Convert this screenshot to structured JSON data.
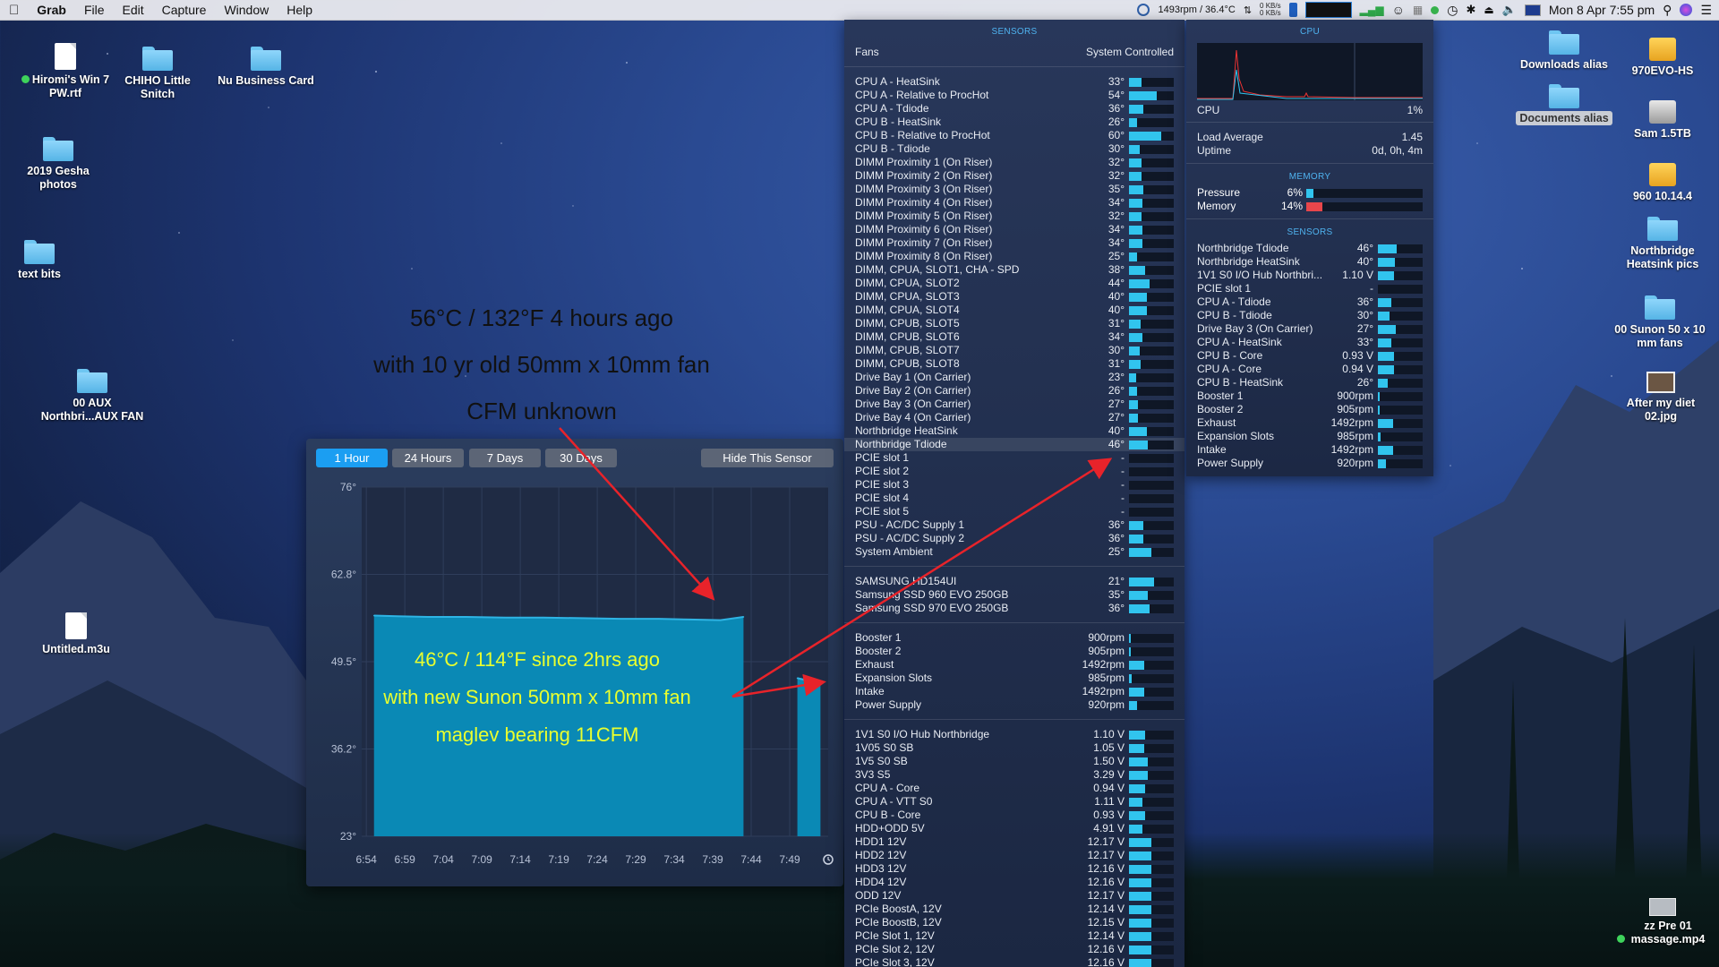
{
  "menubar": {
    "apple": "",
    "app": "Grab",
    "items": [
      "File",
      "Edit",
      "Capture",
      "Window",
      "Help"
    ],
    "status_fan": "1493rpm / 36.4°C",
    "net_up": "0 KB/s",
    "net_down": "0 KB/s",
    "clock": "Mon 8 Apr  7:55 pm"
  },
  "desktop": {
    "icons_left": [
      {
        "label": "Hiromi's Win 7 PW.rtf",
        "kind": "doc",
        "tag": "green"
      },
      {
        "label": "CHIHO Little Snitch",
        "kind": "folder"
      },
      {
        "label": "Nu Business Card",
        "kind": "folder"
      },
      {
        "label": "2019 Gesha photos",
        "kind": "folder"
      },
      {
        "label": "text bits",
        "kind": "folder"
      },
      {
        "label": "00 AUX Northbri...AUX FAN",
        "kind": "folder"
      },
      {
        "label": "Untitled.m3u",
        "kind": "doc"
      }
    ],
    "icons_right": [
      {
        "label": "Downloads alias",
        "kind": "folder"
      },
      {
        "label": "970EVO-HS",
        "kind": "drive"
      },
      {
        "label": "Documents alias",
        "kind": "folder"
      },
      {
        "label": "Sam 1.5TB",
        "kind": "drive-grey"
      },
      {
        "label": "960 10.14.4",
        "kind": "drive"
      },
      {
        "label": "Northbridge Heatsink pics",
        "kind": "folder"
      },
      {
        "label": "00 Sunon 50 x 10 mm fans",
        "kind": "folder"
      },
      {
        "label": "After my diet 02.jpg",
        "kind": "image"
      },
      {
        "label": "zz Pre 01 massage.mp4",
        "kind": "video",
        "tag": "green"
      }
    ]
  },
  "annotations": {
    "top": [
      "56°C / 132°F 4 hours ago",
      "with 10 yr old 50mm x 10mm fan",
      "CFM unknown"
    ],
    "bottom": [
      "46°C / 114°F since 2hrs ago",
      "with new Sunon 50mm x 10mm fan",
      "maglev bearing 11CFM"
    ]
  },
  "graph_window": {
    "tabs": [
      "1 Hour",
      "24 Hours",
      "7 Days",
      "30 Days"
    ],
    "active_tab": "1 Hour",
    "hide_button": "Hide This Sensor",
    "clock_icon": "clock-icon"
  },
  "chart_data": {
    "type": "area",
    "title": "",
    "xlabel": "",
    "ylabel": "",
    "y_ticks": [
      "76°",
      "62.8°",
      "49.5°",
      "36.2°",
      "23°"
    ],
    "ylim": [
      23,
      76
    ],
    "x_ticks": [
      "6:54",
      "6:59",
      "7:04",
      "7:09",
      "7:14",
      "7:19",
      "7:24",
      "7:29",
      "7:34",
      "7:39",
      "7:44",
      "7:49"
    ],
    "fill_color": "#0a89b5",
    "line_color": "#2fb4e4",
    "series": [
      {
        "values": [
          {
            "t": "6:55",
            "v": 56.5
          },
          {
            "t": "6:58",
            "v": 56.4
          },
          {
            "t": "7:02",
            "v": 56.3
          },
          {
            "t": "7:07",
            "v": 56.3
          },
          {
            "t": "7:12",
            "v": 56.2
          },
          {
            "t": "7:17",
            "v": 56.2
          },
          {
            "t": "7:22",
            "v": 56.1
          },
          {
            "t": "7:27",
            "v": 56.0
          },
          {
            "t": "7:32",
            "v": 56.0
          },
          {
            "t": "7:36",
            "v": 55.9
          },
          {
            "t": "7:40",
            "v": 55.8
          },
          {
            "t": "7:43",
            "v": 56.3
          }
        ]
      },
      {
        "values": [
          {
            "t": "7:50",
            "v": 47.0
          },
          {
            "t": "7:53",
            "v": 46.2
          }
        ]
      }
    ]
  },
  "sensors_panel": {
    "header": "SENSORS",
    "fans_label": "Fans",
    "fans_mode": "System Controlled",
    "temps": [
      {
        "name": "CPU A - HeatSink",
        "value": "33°",
        "level": 0.28
      },
      {
        "name": "CPU A - Relative to ProcHot",
        "value": "54°",
        "level": 0.62
      },
      {
        "name": "CPU A - Tdiode",
        "value": "36°",
        "level": 0.32
      },
      {
        "name": "CPU B - HeatSink",
        "value": "26°",
        "level": 0.18
      },
      {
        "name": "CPU B - Relative to ProcHot",
        "value": "60°",
        "level": 0.72
      },
      {
        "name": "CPU B - Tdiode",
        "value": "30°",
        "level": 0.24
      },
      {
        "name": "DIMM Proximity 1 (On Riser)",
        "value": "32°",
        "level": 0.27
      },
      {
        "name": "DIMM Proximity 2 (On Riser)",
        "value": "32°",
        "level": 0.27
      },
      {
        "name": "DIMM Proximity 3 (On Riser)",
        "value": "35°",
        "level": 0.31
      },
      {
        "name": "DIMM Proximity 4 (On Riser)",
        "value": "34°",
        "level": 0.3
      },
      {
        "name": "DIMM Proximity 5 (On Riser)",
        "value": "32°",
        "level": 0.27
      },
      {
        "name": "DIMM Proximity 6 (On Riser)",
        "value": "34°",
        "level": 0.3
      },
      {
        "name": "DIMM Proximity 7 (On Riser)",
        "value": "34°",
        "level": 0.3
      },
      {
        "name": "DIMM Proximity 8 (On Riser)",
        "value": "25°",
        "level": 0.17
      },
      {
        "name": "DIMM, CPUA, SLOT1, CHA - SPD",
        "value": "38°",
        "level": 0.36
      },
      {
        "name": "DIMM, CPUA, SLOT2",
        "value": "44°",
        "level": 0.46
      },
      {
        "name": "DIMM, CPUA, SLOT3",
        "value": "40°",
        "level": 0.4
      },
      {
        "name": "DIMM, CPUA, SLOT4",
        "value": "40°",
        "level": 0.4
      },
      {
        "name": "DIMM, CPUB, SLOT5",
        "value": "31°",
        "level": 0.26
      },
      {
        "name": "DIMM, CPUB, SLOT6",
        "value": "34°",
        "level": 0.3
      },
      {
        "name": "DIMM, CPUB, SLOT7",
        "value": "30°",
        "level": 0.24
      },
      {
        "name": "DIMM, CPUB, SLOT8",
        "value": "31°",
        "level": 0.26
      },
      {
        "name": "Drive Bay 1 (On Carrier)",
        "value": "23°",
        "level": 0.15
      },
      {
        "name": "Drive Bay 2 (On Carrier)",
        "value": "26°",
        "level": 0.18
      },
      {
        "name": "Drive Bay 3 (On Carrier)",
        "value": "27°",
        "level": 0.2
      },
      {
        "name": "Drive Bay 4 (On Carrier)",
        "value": "27°",
        "level": 0.2
      },
      {
        "name": "Northbridge HeatSink",
        "value": "40°",
        "level": 0.4
      },
      {
        "name": "Northbridge Tdiode",
        "value": "46°",
        "level": 0.42,
        "highlight": true
      },
      {
        "name": "PCIE slot 1",
        "value": "-",
        "level": 0
      },
      {
        "name": "PCIE slot 2",
        "value": "-",
        "level": 0
      },
      {
        "name": "PCIE slot 3",
        "value": "-",
        "level": 0
      },
      {
        "name": "PCIE slot 4",
        "value": "-",
        "level": 0
      },
      {
        "name": "PCIE slot 5",
        "value": "-",
        "level": 0
      },
      {
        "name": "PSU - AC/DC Supply 1",
        "value": "36°",
        "level": 0.32
      },
      {
        "name": "PSU - AC/DC Supply 2",
        "value": "36°",
        "level": 0.32
      },
      {
        "name": "System Ambient",
        "value": "25°",
        "level": 0.5
      }
    ],
    "drives": [
      {
        "name": "SAMSUNG HD154UI",
        "value": "21°",
        "level": 0.55
      },
      {
        "name": "Samsung SSD 960 EVO 250GB",
        "value": "35°",
        "level": 0.42
      },
      {
        "name": "Samsung SSD 970 EVO 250GB",
        "value": "36°",
        "level": 0.45
      }
    ],
    "fans": [
      {
        "name": "Booster 1",
        "value": "900rpm",
        "level": 0.04
      },
      {
        "name": "Booster 2",
        "value": "905rpm",
        "level": 0.04
      },
      {
        "name": "Exhaust",
        "value": "1492rpm",
        "level": 0.34
      },
      {
        "name": "Expansion Slots",
        "value": "985rpm",
        "level": 0.06
      },
      {
        "name": "Intake",
        "value": "1492rpm",
        "level": 0.34
      },
      {
        "name": "Power Supply",
        "value": "920rpm",
        "level": 0.18
      }
    ],
    "voltages": [
      {
        "name": "1V1 S0 I/O Hub Northbridge",
        "value": "1.10 V",
        "level": 0.36
      },
      {
        "name": "1V05 S0 SB",
        "value": "1.05 V",
        "level": 0.34
      },
      {
        "name": "1V5 S0 SB",
        "value": "1.50 V",
        "level": 0.42
      },
      {
        "name": "3V3 S5",
        "value": "3.29 V",
        "level": 0.42
      },
      {
        "name": "CPU A - Core",
        "value": "0.94 V",
        "level": 0.36
      },
      {
        "name": "CPU A - VTT S0",
        "value": "1.11 V",
        "level": 0.3
      },
      {
        "name": "CPU B - Core",
        "value": "0.93 V",
        "level": 0.36
      },
      {
        "name": "HDD+ODD 5V",
        "value": "4.91 V",
        "level": 0.3
      },
      {
        "name": "HDD1 12V",
        "value": "12.17 V",
        "level": 0.5
      },
      {
        "name": "HDD2 12V",
        "value": "12.17 V",
        "level": 0.5
      },
      {
        "name": "HDD3 12V",
        "value": "12.16 V",
        "level": 0.5
      },
      {
        "name": "HDD4 12V",
        "value": "12.16 V",
        "level": 0.5
      },
      {
        "name": "ODD 12V",
        "value": "12.17 V",
        "level": 0.5
      },
      {
        "name": "PCIe BoostA, 12V",
        "value": "12.14 V",
        "level": 0.5
      },
      {
        "name": "PCIe BoostB, 12V",
        "value": "12.15 V",
        "level": 0.5
      },
      {
        "name": "PCIe Slot 1, 12V",
        "value": "12.14 V",
        "level": 0.5
      },
      {
        "name": "PCIe Slot 2, 12V",
        "value": "12.16 V",
        "level": 0.5
      },
      {
        "name": "PCIe Slot 3, 12V",
        "value": "12.16 V",
        "level": 0.5
      }
    ]
  },
  "cpu_panel": {
    "header": "CPU",
    "cpu_label": "CPU",
    "cpu_value": "1%",
    "load_label": "Load Average",
    "load_value": "1.45",
    "uptime_label": "Uptime",
    "uptime_value": "0d, 0h, 4m",
    "memory_header": "MEMORY",
    "pressure_label": "Pressure",
    "pressure_value": "6%",
    "pressure_level": 0.06,
    "memory_label": "Memory",
    "memory_value": "14%",
    "memory_level": 0.14,
    "sensors_header": "SENSORS",
    "sensors": [
      {
        "name": "Northbridge Tdiode",
        "value": "46°",
        "level": 0.42
      },
      {
        "name": "Northbridge HeatSink",
        "value": "40°",
        "level": 0.38
      },
      {
        "name": "1V1 S0 I/O Hub Northbri...",
        "value": "1.10 V",
        "level": 0.36
      },
      {
        "name": "PCIE slot 1",
        "value": "-",
        "level": 0
      },
      {
        "name": "CPU A - Tdiode",
        "value": "36°",
        "level": 0.3
      },
      {
        "name": "CPU B - Tdiode",
        "value": "30°",
        "level": 0.25
      },
      {
        "name": "Drive Bay 3 (On Carrier)",
        "value": "27°",
        "level": 0.4
      },
      {
        "name": "CPU A - HeatSink",
        "value": "33°",
        "level": 0.3
      },
      {
        "name": "CPU B - Core",
        "value": "0.93 V",
        "level": 0.36
      },
      {
        "name": "CPU A - Core",
        "value": "0.94 V",
        "level": 0.36
      },
      {
        "name": "CPU B - HeatSink",
        "value": "26°",
        "level": 0.22
      },
      {
        "name": "Booster 1",
        "value": "900rpm",
        "level": 0.04
      },
      {
        "name": "Booster 2",
        "value": "905rpm",
        "level": 0.04
      },
      {
        "name": "Exhaust",
        "value": "1492rpm",
        "level": 0.34
      },
      {
        "name": "Expansion Slots",
        "value": "985rpm",
        "level": 0.06
      },
      {
        "name": "Intake",
        "value": "1492rpm",
        "level": 0.34
      },
      {
        "name": "Power Supply",
        "value": "920rpm",
        "level": 0.18
      }
    ]
  }
}
